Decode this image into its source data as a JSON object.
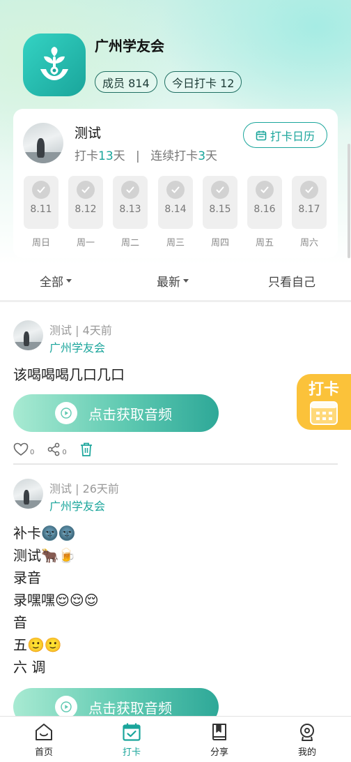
{
  "group": {
    "name": "广州学友会",
    "members_label": "成员 814",
    "today_label": "今日打卡 12",
    "logo_icon": "sprout-hand-icon"
  },
  "profile": {
    "name": "测试",
    "stats_prefix": "打卡",
    "days_total": "13",
    "days_suffix": "天",
    "separator": "|",
    "streak_prefix": "连续打卡",
    "streak_days": "3",
    "calendar_label": "打卡日历"
  },
  "week": [
    {
      "date": "8.11",
      "weekday": "周日"
    },
    {
      "date": "8.12",
      "weekday": "周一"
    },
    {
      "date": "8.13",
      "weekday": "周二"
    },
    {
      "date": "8.14",
      "weekday": "周三"
    },
    {
      "date": "8.15",
      "weekday": "周四"
    },
    {
      "date": "8.16",
      "weekday": "周五"
    },
    {
      "date": "8.17",
      "weekday": "周六"
    }
  ],
  "filters": {
    "all": "全部",
    "latest": "最新",
    "mine": "只看自己"
  },
  "posts": [
    {
      "meta": "测试 | 4天前",
      "group": "广州学友会",
      "lines": [
        "该喝喝喝几口几口"
      ],
      "audio_label": "点击获取音频",
      "likes": "0",
      "shares": "0"
    },
    {
      "meta": "测试 | 26天前",
      "group": "广州学友会",
      "lines": [
        "补卡🌚🌚",
        "测试🐂🍺",
        "录音",
        "录嘿嘿😌😌😌",
        "音",
        "五🙂🙂",
        "六 调"
      ],
      "audio_label": "点击获取音频"
    }
  ],
  "fab": {
    "label": "打卡"
  },
  "tabs": [
    {
      "label": "首页",
      "icon": "home-icon"
    },
    {
      "label": "打卡",
      "icon": "checkin-calendar-icon"
    },
    {
      "label": "分享",
      "icon": "book-icon"
    },
    {
      "label": "我的",
      "icon": "user-icon"
    }
  ],
  "colors": {
    "accent": "#1aa59b",
    "fab": "#fbc23a"
  }
}
